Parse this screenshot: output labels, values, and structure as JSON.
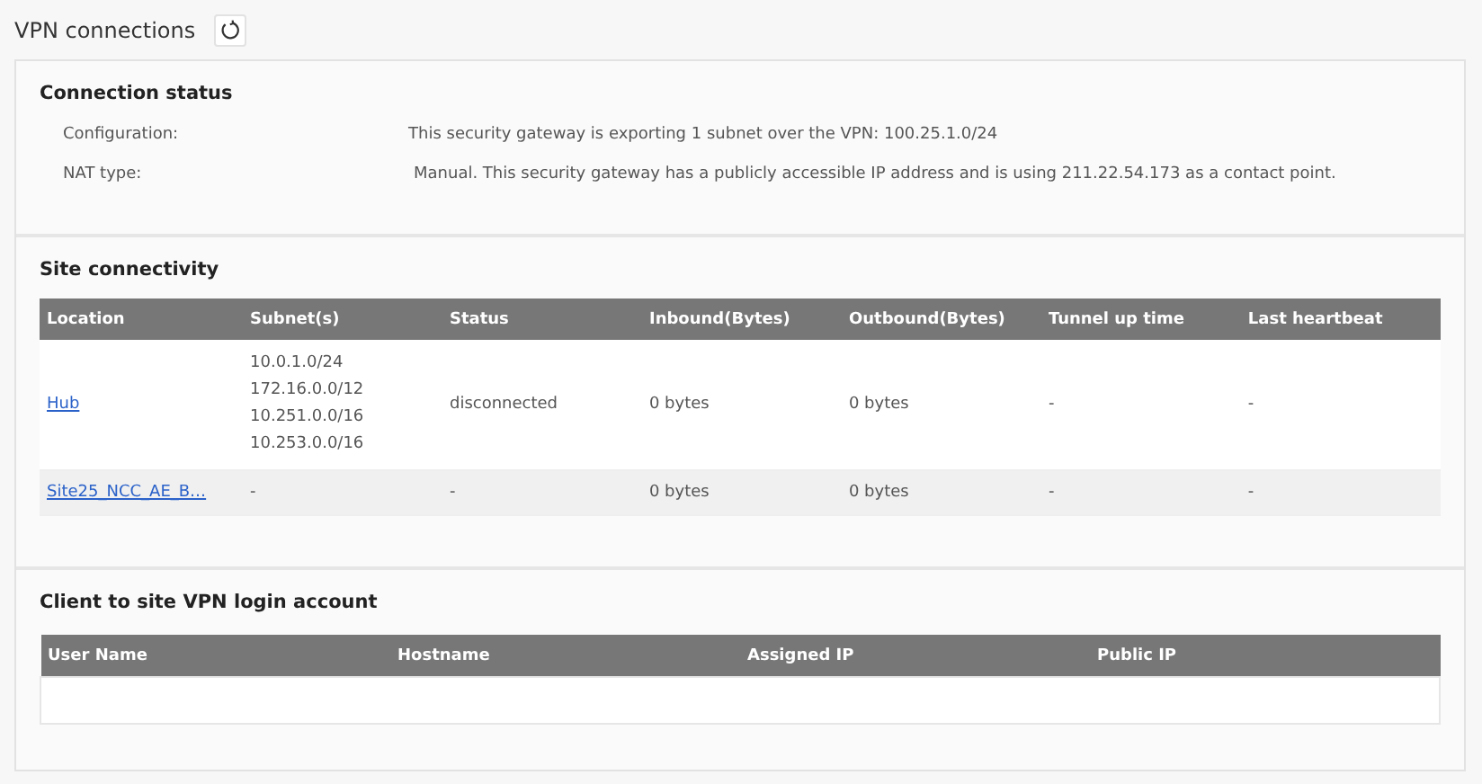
{
  "page_title": "VPN connections",
  "connection_status": {
    "title": "Connection status",
    "rows": [
      {
        "label": "Configuration:",
        "value": "This security gateway is exporting 1 subnet over the VPN: 100.25.1.0/24"
      },
      {
        "label": "NAT type:",
        "value": "Manual. This security gateway has a publicly accessible IP address and is using 211.22.54.173 as a contact point."
      }
    ]
  },
  "site_connectivity": {
    "title": "Site connectivity",
    "columns": [
      "Location",
      "Subnet(s)",
      "Status",
      "Inbound(Bytes)",
      "Outbound(Bytes)",
      "Tunnel up time",
      "Last heartbeat"
    ],
    "rows": [
      {
        "location": "Hub",
        "subnets": [
          "10.0.1.0/24",
          "172.16.0.0/12",
          "10.251.0.0/16",
          "10.253.0.0/16"
        ],
        "status": "disconnected",
        "inbound": "0 bytes",
        "outbound": "0 bytes",
        "tunnel_up_time": "-",
        "last_heartbeat": "-"
      },
      {
        "location": "Site25_NCC_AE_B…",
        "subnets": [
          "-"
        ],
        "status": "-",
        "inbound": "0 bytes",
        "outbound": "0 bytes",
        "tunnel_up_time": "-",
        "last_heartbeat": "-"
      }
    ]
  },
  "client_to_site": {
    "title": "Client to site VPN login account",
    "columns": [
      "User Name",
      "Hostname",
      "Assigned IP",
      "Public IP"
    ]
  }
}
